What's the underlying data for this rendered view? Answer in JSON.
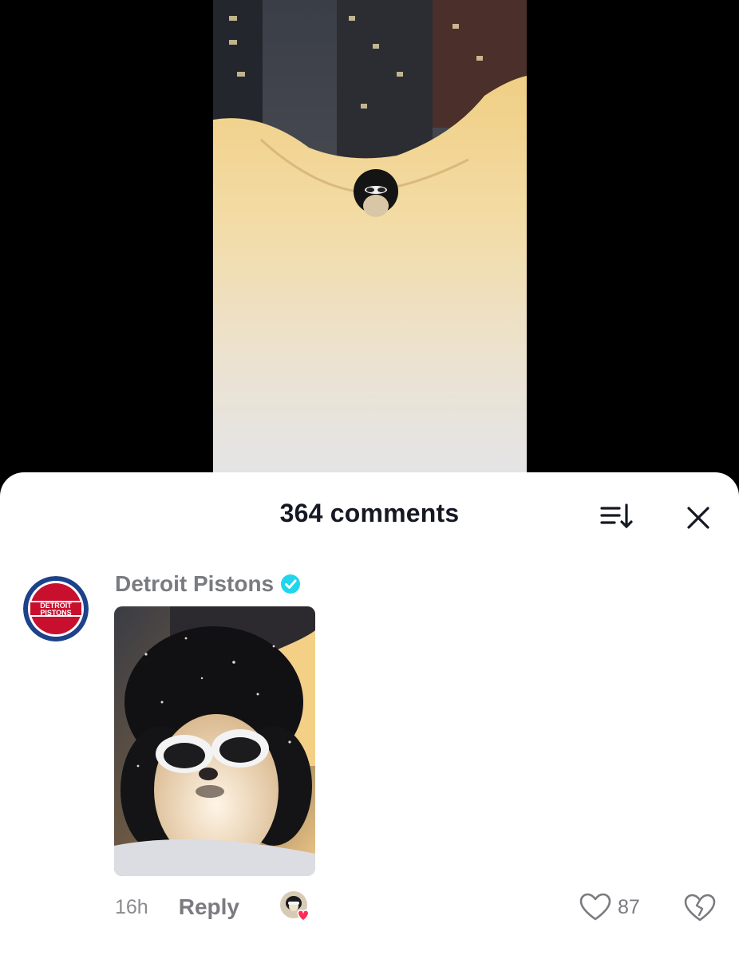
{
  "sheet": {
    "comments_count_label": "364 comments",
    "sort_icon": "sort-icon",
    "close_icon": "close-icon"
  },
  "comment": {
    "author": "Detroit Pistons",
    "verified": true,
    "avatar_logo_text_line1": "DETROIT",
    "avatar_logo_text_line2": "PISTONS",
    "timestamp": "16h",
    "reply_label": "Reply",
    "like_count": "87",
    "liked_by_creator": true
  },
  "colors": {
    "primary_text": "#161823",
    "secondary_text": "#7a7b80",
    "verified": "#20d5ec",
    "creator_heart": "#fe2c55",
    "pistons_red": "#c8102e",
    "pistons_blue": "#1d428a"
  }
}
